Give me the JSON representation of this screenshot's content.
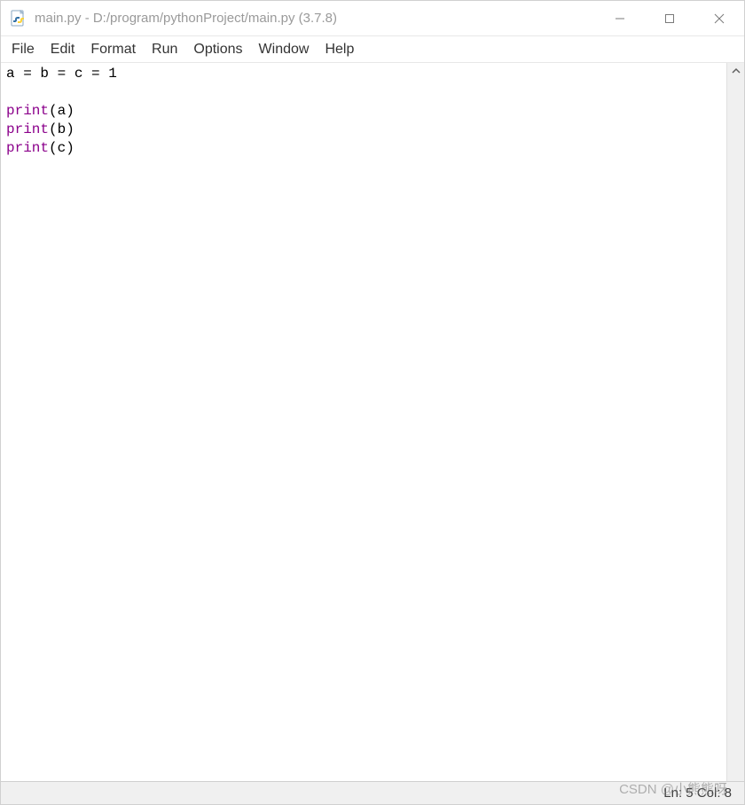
{
  "window": {
    "title": "main.py - D:/program/pythonProject/main.py (3.7.8)"
  },
  "menu": {
    "items": [
      "File",
      "Edit",
      "Format",
      "Run",
      "Options",
      "Window",
      "Help"
    ]
  },
  "code": {
    "lines": [
      {
        "segments": [
          {
            "t": "a = b = c = ",
            "cls": ""
          },
          {
            "t": "1",
            "cls": "tok-num"
          }
        ]
      },
      {
        "segments": [
          {
            "t": "",
            "cls": ""
          }
        ]
      },
      {
        "segments": [
          {
            "t": "print",
            "cls": "tok-builtin"
          },
          {
            "t": "(a)",
            "cls": ""
          }
        ]
      },
      {
        "segments": [
          {
            "t": "print",
            "cls": "tok-builtin"
          },
          {
            "t": "(b)",
            "cls": ""
          }
        ]
      },
      {
        "segments": [
          {
            "t": "print",
            "cls": "tok-builtin"
          },
          {
            "t": "(c)",
            "cls": ""
          }
        ]
      }
    ]
  },
  "status": {
    "line_col": "Ln: 5  Col: 8"
  },
  "watermark": "CSDN @小熊熊呀"
}
